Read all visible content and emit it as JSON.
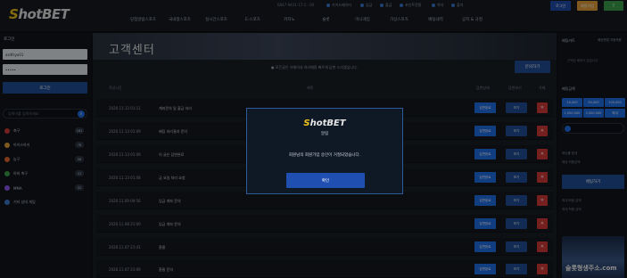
{
  "header": {
    "logo_prefix": "S",
    "logo_rest": "hotBET",
    "account_line": "0847-9431-17-1 · 00",
    "utils": [
      "가이드베이터",
      "입금",
      "출금",
      "포인트전환",
      "쪽지",
      "출석"
    ],
    "login_label": "로그인",
    "join_label": "회원가입",
    "extra_label": "T"
  },
  "nav": [
    "당첨알람스포츠",
    "국내형스포츠",
    "실시간스포츠",
    "E-스포츠",
    "카지노",
    "슬롯",
    "미니게임",
    "가상스포츠",
    "배팅내역",
    "공지 & 규정"
  ],
  "left": {
    "login_label": "로그인",
    "id_value": "asdfsyo01",
    "pw_value": "•••••",
    "login_button": "로그인",
    "search_placeholder": "검색어를 입력하세요",
    "sports": [
      {
        "name": "축구",
        "count": "181",
        "color": "#d83a3a"
      },
      {
        "name": "아이스하키",
        "count": "78",
        "color": "#e8a33b"
      },
      {
        "name": "농구",
        "count": "56",
        "color": "#e86b2b"
      },
      {
        "name": "야외 축구",
        "count": "41",
        "color": "#3fa34d"
      },
      {
        "name": "MMA",
        "count": "32",
        "color": "#8b5cf6"
      },
      {
        "name": "기타 상대 게임",
        "count": "8",
        "color": "#3a7bd5"
      }
    ]
  },
  "main": {
    "page_title": "고객센터",
    "notice": "● 모든글은 삭제이내 처리예정 빠르게 답변 드리겠습니다.",
    "write_button": "문의하기",
    "columns": {
      "date": "작성시간",
      "subject": "제목",
      "c3": "답변상태",
      "c4": "답변보기",
      "c5": "삭제"
    },
    "rows": [
      {
        "date": "2020.11.13 01:11",
        "subject": "계좌문의 및 출금 처리",
        "b1": "답변완료",
        "b2": "보기",
        "b3": "✕"
      },
      {
        "date": "2020.11.13 01:09",
        "subject": "배팅 처리결과 문의",
        "b1": "답변완료",
        "b2": "보기",
        "b3": "✕"
      },
      {
        "date": "2020.11.13 01:09",
        "subject": "이 글은 답변완료",
        "b1": "답변완료",
        "b2": "보기",
        "b3": "✕"
      },
      {
        "date": "2020.11.13 01:08",
        "subject": "금 요일 처리 요청",
        "b1": "답변완료",
        "b2": "보기",
        "b3": "✕"
      },
      {
        "date": "2020.11.09 09:56",
        "subject": "입금 계좌 문의",
        "b1": "답변완료",
        "b2": "보기",
        "b3": "✕"
      },
      {
        "date": "2020.11.08 21:00",
        "subject": "입금 계좌 문의",
        "b1": "답변완료",
        "b2": "보기",
        "b3": "✕"
      },
      {
        "date": "2020.11.07 21:41",
        "subject": "환율",
        "b1": "답변완료",
        "b2": "보기",
        "b3": "✕"
      },
      {
        "date": "2020.11.07 21:09",
        "subject": "환율 문의",
        "b1": "답변완료",
        "b2": "보기",
        "b3": "✕"
      }
    ]
  },
  "right": {
    "betslip_label": "배팅카트",
    "toggle_label": "배당변경 자동적용",
    "empty_text": "선택된 배팅이 없습니다",
    "amount_label": "배팅금액",
    "chips": [
      "10,000",
      "50,000",
      "100,000",
      "1,000,000",
      "5,000,000",
      "최대"
    ],
    "rows": [
      "배당률 합계",
      "예상 적중금액"
    ],
    "bet_button": "배팅하기",
    "limits": [
      "최대 배팅 금액",
      "최대 적중 금액"
    ],
    "promo_text": "슬롯형생주소.com"
  },
  "modal": {
    "logo_prefix": "S",
    "logo_rest": "hotBET",
    "title": "알림",
    "message": "회원님의 회원가입 승인이 거절되었습니다.",
    "confirm_button": "확인"
  }
}
